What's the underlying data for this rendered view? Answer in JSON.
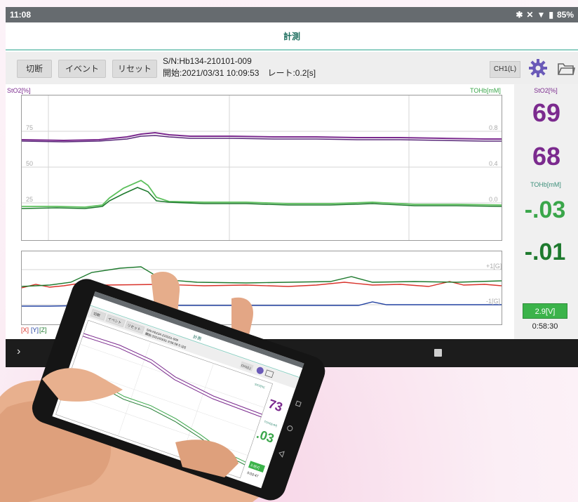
{
  "statusbar": {
    "time": "11:08",
    "icons": [
      "bluetooth-icon",
      "mute-icon",
      "wifi-icon",
      "battery-icon"
    ],
    "battery": "85%"
  },
  "header": {
    "title": "計測"
  },
  "toolbar": {
    "disconnect_label": "切断",
    "event_label": "イベント",
    "reset_label": "リセット",
    "serial": "S/N:Hb134-210101-009",
    "start_info": "開始:2021/03/31 10:09:53　レート:0.2[s]",
    "channel_label": "CH1(L)"
  },
  "upper_chart": {
    "left_axis_label": "StO2[%]",
    "right_axis_label": "TOHb[mM]",
    "left_ticks": [
      "75",
      "50",
      "25"
    ],
    "right_ticks": [
      "0.8",
      "0.4",
      "0.0"
    ]
  },
  "lower_chart": {
    "right_ticks": [
      "+1[G]",
      "-1[G]"
    ],
    "legend_x": "[X]",
    "legend_y": "[Y]",
    "legend_z": "[Z]"
  },
  "side_panel": {
    "sto2_label": "StO2[%]",
    "sto2_value_1": "69",
    "sto2_value_2": "68",
    "tohb_label": "TOHb[mM]",
    "tohb_value_1": "-.03",
    "tohb_value_2": "-.01",
    "voltage": "2.9[V]",
    "elapsed": "0:58:30"
  },
  "phone": {
    "header_title": "計測",
    "disconnect_label": "切断",
    "event_label": "イベント",
    "reset_label": "リセット",
    "serial": "S/N:Hb134-210101-009",
    "start_info": "開始:2021/03/31 9:56:58 0.1[s]",
    "channel_label": "CH1(L)",
    "sto2_label": "StO2[%]",
    "sto2_value": "73",
    "tohb_label": "TOHb[mM]",
    "tohb_value": ".03",
    "voltage": "3.9[V]",
    "elapsed": "0:03:47"
  },
  "colors": {
    "purple": "#7b2a8e",
    "green_value": "#3aa64a",
    "green_trace_dark": "#1e7a2e",
    "green_trace_light": "#5cc05c",
    "red_trace": "#d8322a",
    "blue_trace": "#2140a0",
    "navbar": "#1c1c1c",
    "statusbar": "#666b6f"
  }
}
